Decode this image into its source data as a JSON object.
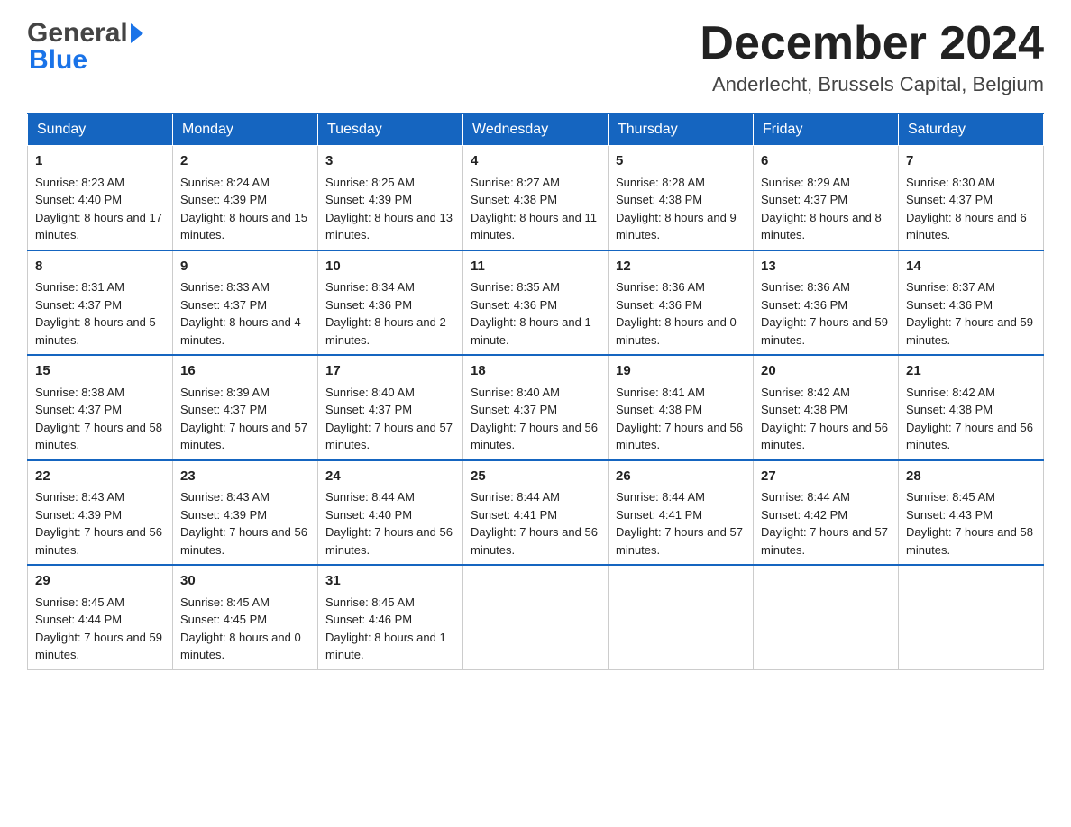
{
  "header": {
    "month_title": "December 2024",
    "location": "Anderlecht, Brussels Capital, Belgium",
    "logo_line1": "General",
    "logo_line2": "Blue"
  },
  "days_of_week": [
    "Sunday",
    "Monday",
    "Tuesday",
    "Wednesday",
    "Thursday",
    "Friday",
    "Saturday"
  ],
  "weeks": [
    [
      {
        "day": "1",
        "sunrise": "Sunrise: 8:23 AM",
        "sunset": "Sunset: 4:40 PM",
        "daylight": "Daylight: 8 hours and 17 minutes."
      },
      {
        "day": "2",
        "sunrise": "Sunrise: 8:24 AM",
        "sunset": "Sunset: 4:39 PM",
        "daylight": "Daylight: 8 hours and 15 minutes."
      },
      {
        "day": "3",
        "sunrise": "Sunrise: 8:25 AM",
        "sunset": "Sunset: 4:39 PM",
        "daylight": "Daylight: 8 hours and 13 minutes."
      },
      {
        "day": "4",
        "sunrise": "Sunrise: 8:27 AM",
        "sunset": "Sunset: 4:38 PM",
        "daylight": "Daylight: 8 hours and 11 minutes."
      },
      {
        "day": "5",
        "sunrise": "Sunrise: 8:28 AM",
        "sunset": "Sunset: 4:38 PM",
        "daylight": "Daylight: 8 hours and 9 minutes."
      },
      {
        "day": "6",
        "sunrise": "Sunrise: 8:29 AM",
        "sunset": "Sunset: 4:37 PM",
        "daylight": "Daylight: 8 hours and 8 minutes."
      },
      {
        "day": "7",
        "sunrise": "Sunrise: 8:30 AM",
        "sunset": "Sunset: 4:37 PM",
        "daylight": "Daylight: 8 hours and 6 minutes."
      }
    ],
    [
      {
        "day": "8",
        "sunrise": "Sunrise: 8:31 AM",
        "sunset": "Sunset: 4:37 PM",
        "daylight": "Daylight: 8 hours and 5 minutes."
      },
      {
        "day": "9",
        "sunrise": "Sunrise: 8:33 AM",
        "sunset": "Sunset: 4:37 PM",
        "daylight": "Daylight: 8 hours and 4 minutes."
      },
      {
        "day": "10",
        "sunrise": "Sunrise: 8:34 AM",
        "sunset": "Sunset: 4:36 PM",
        "daylight": "Daylight: 8 hours and 2 minutes."
      },
      {
        "day": "11",
        "sunrise": "Sunrise: 8:35 AM",
        "sunset": "Sunset: 4:36 PM",
        "daylight": "Daylight: 8 hours and 1 minute."
      },
      {
        "day": "12",
        "sunrise": "Sunrise: 8:36 AM",
        "sunset": "Sunset: 4:36 PM",
        "daylight": "Daylight: 8 hours and 0 minutes."
      },
      {
        "day": "13",
        "sunrise": "Sunrise: 8:36 AM",
        "sunset": "Sunset: 4:36 PM",
        "daylight": "Daylight: 7 hours and 59 minutes."
      },
      {
        "day": "14",
        "sunrise": "Sunrise: 8:37 AM",
        "sunset": "Sunset: 4:36 PM",
        "daylight": "Daylight: 7 hours and 59 minutes."
      }
    ],
    [
      {
        "day": "15",
        "sunrise": "Sunrise: 8:38 AM",
        "sunset": "Sunset: 4:37 PM",
        "daylight": "Daylight: 7 hours and 58 minutes."
      },
      {
        "day": "16",
        "sunrise": "Sunrise: 8:39 AM",
        "sunset": "Sunset: 4:37 PM",
        "daylight": "Daylight: 7 hours and 57 minutes."
      },
      {
        "day": "17",
        "sunrise": "Sunrise: 8:40 AM",
        "sunset": "Sunset: 4:37 PM",
        "daylight": "Daylight: 7 hours and 57 minutes."
      },
      {
        "day": "18",
        "sunrise": "Sunrise: 8:40 AM",
        "sunset": "Sunset: 4:37 PM",
        "daylight": "Daylight: 7 hours and 56 minutes."
      },
      {
        "day": "19",
        "sunrise": "Sunrise: 8:41 AM",
        "sunset": "Sunset: 4:38 PM",
        "daylight": "Daylight: 7 hours and 56 minutes."
      },
      {
        "day": "20",
        "sunrise": "Sunrise: 8:42 AM",
        "sunset": "Sunset: 4:38 PM",
        "daylight": "Daylight: 7 hours and 56 minutes."
      },
      {
        "day": "21",
        "sunrise": "Sunrise: 8:42 AM",
        "sunset": "Sunset: 4:38 PM",
        "daylight": "Daylight: 7 hours and 56 minutes."
      }
    ],
    [
      {
        "day": "22",
        "sunrise": "Sunrise: 8:43 AM",
        "sunset": "Sunset: 4:39 PM",
        "daylight": "Daylight: 7 hours and 56 minutes."
      },
      {
        "day": "23",
        "sunrise": "Sunrise: 8:43 AM",
        "sunset": "Sunset: 4:39 PM",
        "daylight": "Daylight: 7 hours and 56 minutes."
      },
      {
        "day": "24",
        "sunrise": "Sunrise: 8:44 AM",
        "sunset": "Sunset: 4:40 PM",
        "daylight": "Daylight: 7 hours and 56 minutes."
      },
      {
        "day": "25",
        "sunrise": "Sunrise: 8:44 AM",
        "sunset": "Sunset: 4:41 PM",
        "daylight": "Daylight: 7 hours and 56 minutes."
      },
      {
        "day": "26",
        "sunrise": "Sunrise: 8:44 AM",
        "sunset": "Sunset: 4:41 PM",
        "daylight": "Daylight: 7 hours and 57 minutes."
      },
      {
        "day": "27",
        "sunrise": "Sunrise: 8:44 AM",
        "sunset": "Sunset: 4:42 PM",
        "daylight": "Daylight: 7 hours and 57 minutes."
      },
      {
        "day": "28",
        "sunrise": "Sunrise: 8:45 AM",
        "sunset": "Sunset: 4:43 PM",
        "daylight": "Daylight: 7 hours and 58 minutes."
      }
    ],
    [
      {
        "day": "29",
        "sunrise": "Sunrise: 8:45 AM",
        "sunset": "Sunset: 4:44 PM",
        "daylight": "Daylight: 7 hours and 59 minutes."
      },
      {
        "day": "30",
        "sunrise": "Sunrise: 8:45 AM",
        "sunset": "Sunset: 4:45 PM",
        "daylight": "Daylight: 8 hours and 0 minutes."
      },
      {
        "day": "31",
        "sunrise": "Sunrise: 8:45 AM",
        "sunset": "Sunset: 4:46 PM",
        "daylight": "Daylight: 8 hours and 1 minute."
      },
      null,
      null,
      null,
      null
    ]
  ]
}
